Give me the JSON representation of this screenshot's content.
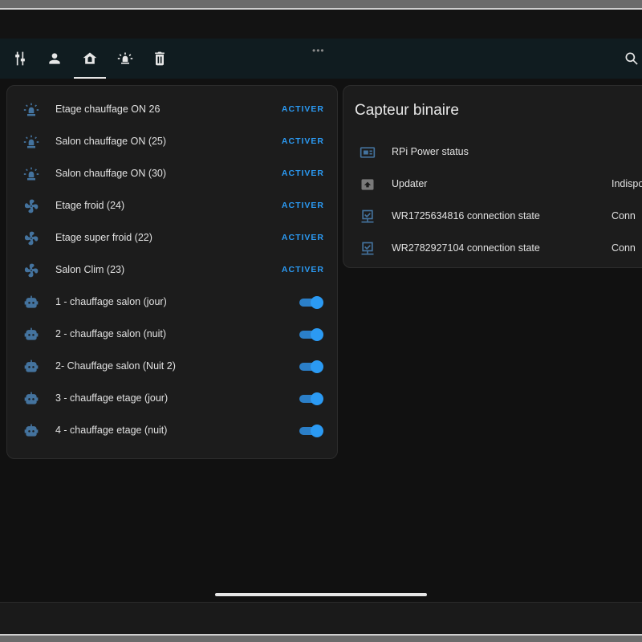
{
  "toolbar": {
    "tabs": [
      {
        "icon": "tune-icon"
      },
      {
        "icon": "person-icon"
      },
      {
        "icon": "home-icon",
        "active": true
      },
      {
        "icon": "alarm-light-icon"
      },
      {
        "icon": "delete-icon"
      }
    ],
    "overflow": "•••",
    "search_icon": "search-icon"
  },
  "scenes_card": {
    "rows": [
      {
        "icon": "siren-icon",
        "label": "Etage chauffage ON 26",
        "action": "ACTIVER"
      },
      {
        "icon": "siren-icon",
        "label": "Salon chauffage ON (25)",
        "action": "ACTIVER"
      },
      {
        "icon": "siren-icon",
        "label": "Salon chauffage ON (30)",
        "action": "ACTIVER"
      },
      {
        "icon": "fan-icon",
        "label": "Etage froid (24)",
        "action": "ACTIVER"
      },
      {
        "icon": "fan-icon",
        "label": "Etage super froid (22)",
        "action": "ACTIVER"
      },
      {
        "icon": "fan-icon",
        "label": "Salon Clim (23)",
        "action": "ACTIVER"
      }
    ],
    "automations": [
      {
        "icon": "robot-icon",
        "label": "1 - chauffage salon (jour)",
        "on": true
      },
      {
        "icon": "robot-icon",
        "label": "2 - chauffage salon (nuit)",
        "on": true
      },
      {
        "icon": "robot-icon",
        "label": "2- Chauffage salon (Nuit 2)",
        "on": true
      },
      {
        "icon": "robot-icon",
        "label": "3 - chauffage etage (jour)",
        "on": true
      },
      {
        "icon": "robot-icon",
        "label": "4 - chauffage etage (nuit)",
        "on": true
      }
    ]
  },
  "binary_card": {
    "title": "Capteur binaire",
    "rows": [
      {
        "icon": "raspberry-pi-icon",
        "label": "RPi Power status",
        "value": ""
      },
      {
        "icon": "package-up-icon",
        "label": "Updater",
        "value": "Indispo"
      },
      {
        "icon": "lan-connect-icon",
        "label": "WR1725634816 connection state",
        "value": "Conn"
      },
      {
        "icon": "lan-connect-icon",
        "label": "WR2782927104 connection state",
        "value": "Conn"
      }
    ]
  },
  "colors": {
    "accent": "#2b9af3",
    "icon": "#44739e",
    "card": "#1c1c1c",
    "background": "#111111",
    "toolbar": "#101c20"
  }
}
